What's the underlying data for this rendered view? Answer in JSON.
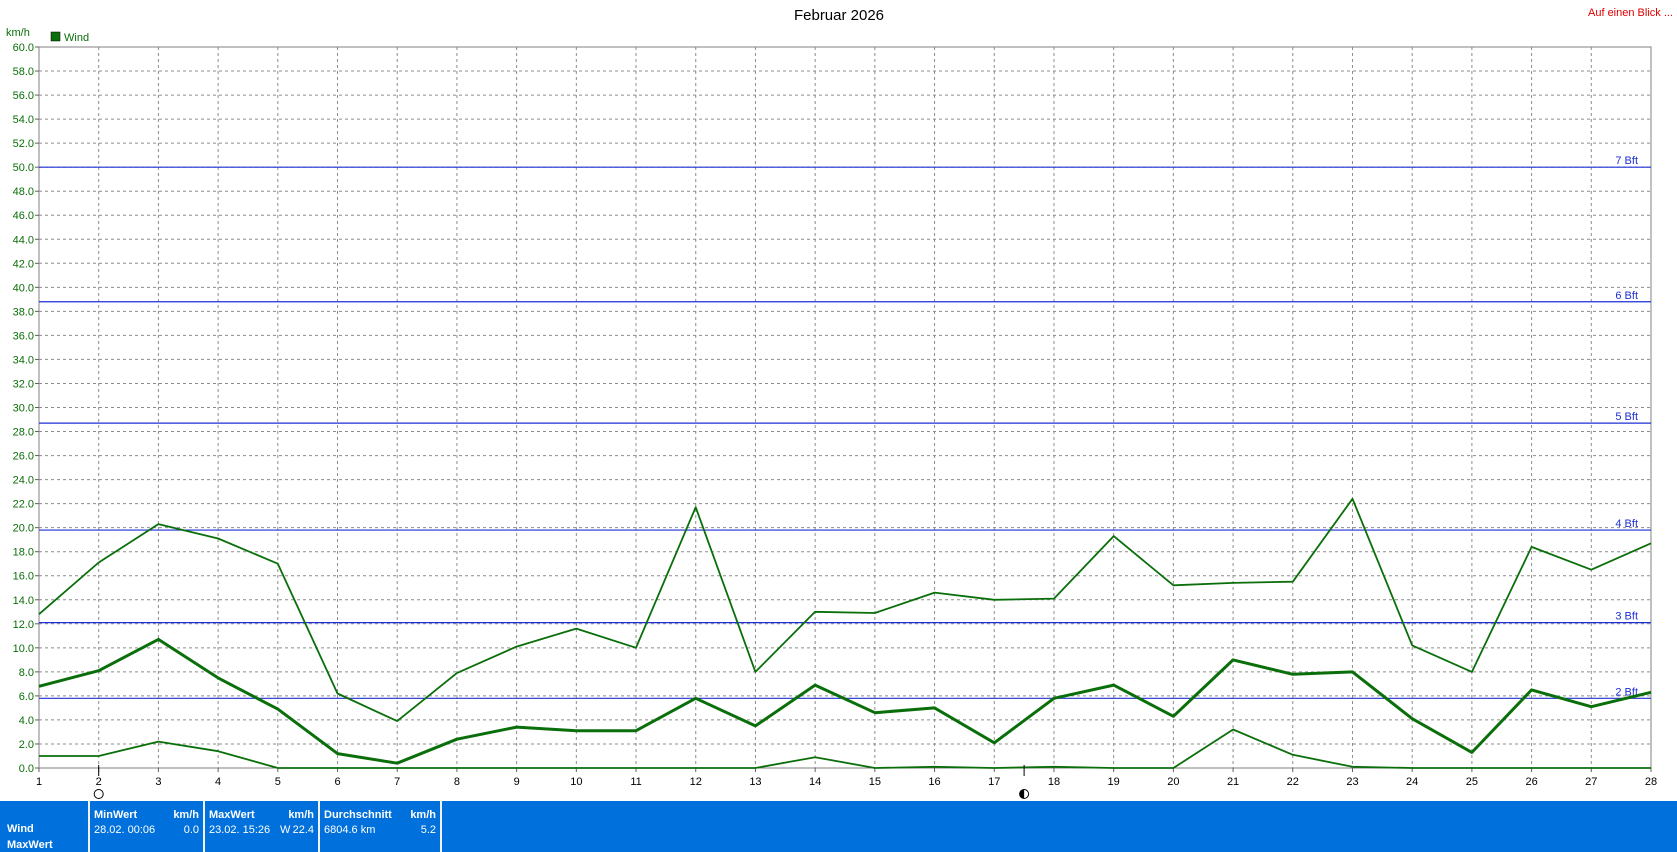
{
  "title": "Februar 2026",
  "link_label": "Auf einen Blick ...",
  "y_unit": "km/h",
  "legend": [
    {
      "label": "Wind",
      "color": "#0a6f0a"
    }
  ],
  "chart_data": {
    "type": "line",
    "title": "Februar 2026",
    "ylabel": "km/h",
    "xlabel": "",
    "ylim": [
      0,
      60
    ],
    "xlim": [
      1,
      28
    ],
    "y_tick_step": 2,
    "grid": true,
    "legend_position": "top-left",
    "x": [
      1,
      2,
      3,
      4,
      5,
      6,
      7,
      8,
      9,
      10,
      11,
      12,
      13,
      14,
      15,
      16,
      17,
      18,
      19,
      20,
      21,
      22,
      23,
      24,
      25,
      26,
      27,
      28
    ],
    "series": [
      {
        "name": "Wind",
        "role": "max",
        "stroke_weight": "normal",
        "color": "#0a6f0a",
        "values": [
          12.8,
          17.1,
          20.3,
          19.1,
          17.0,
          6.2,
          3.9,
          7.9,
          10.1,
          11.6,
          10.0,
          21.7,
          8.0,
          13.0,
          12.9,
          14.6,
          14.0,
          14.1,
          19.3,
          15.2,
          15.4,
          15.5,
          22.4,
          10.2,
          8.0,
          18.4,
          16.5,
          18.7
        ]
      },
      {
        "name": "Wind",
        "role": "average",
        "stroke_weight": "thick",
        "color": "#0a6f0a",
        "values": [
          6.8,
          8.1,
          10.7,
          7.5,
          4.9,
          1.2,
          0.4,
          2.4,
          3.4,
          3.1,
          3.1,
          5.8,
          3.5,
          6.9,
          4.6,
          5.0,
          2.1,
          5.8,
          6.9,
          4.3,
          9.0,
          7.8,
          8.0,
          4.1,
          1.3,
          6.5,
          5.1,
          6.3
        ]
      },
      {
        "name": "Wind",
        "role": "min",
        "stroke_weight": "normal",
        "color": "#0a6f0a",
        "values": [
          1.0,
          1.0,
          2.2,
          1.4,
          0.0,
          0.0,
          0.0,
          0.0,
          0.0,
          0.0,
          0.0,
          0.0,
          0.0,
          0.9,
          0.0,
          0.1,
          0.0,
          0.1,
          0.0,
          0.0,
          3.2,
          1.1,
          0.1,
          0.0,
          0.0,
          0.0,
          0.0,
          0.0
        ]
      }
    ],
    "reference_lines": [
      {
        "label": "7 Bft",
        "value": 50.0
      },
      {
        "label": "6 Bft",
        "value": 38.8
      },
      {
        "label": "5 Bft",
        "value": 28.7
      },
      {
        "label": "4 Bft",
        "value": 19.8
      },
      {
        "label": "3 Bft",
        "value": 12.1
      },
      {
        "label": "2 Bft",
        "value": 5.8
      }
    ],
    "reference_color": "#1f2fd6",
    "moon_markers": [
      {
        "x": 2.0,
        "phase": "new"
      },
      {
        "x": 17.5,
        "phase": "full"
      }
    ]
  },
  "stats": {
    "row_labels": [
      "Wind",
      "MaxWert"
    ],
    "min": {
      "header": "MinWert",
      "unit": "km/h",
      "when": "28.02.  00:06",
      "value": "0.0"
    },
    "max": {
      "header": "MaxWert",
      "unit": "km/h",
      "when": "23.02.  15:26",
      "direction": "W",
      "value": "22.4"
    },
    "avg": {
      "header": "Durchschnitt",
      "unit": "km/h",
      "distance": "6804.6 km",
      "value": "5.2"
    }
  }
}
